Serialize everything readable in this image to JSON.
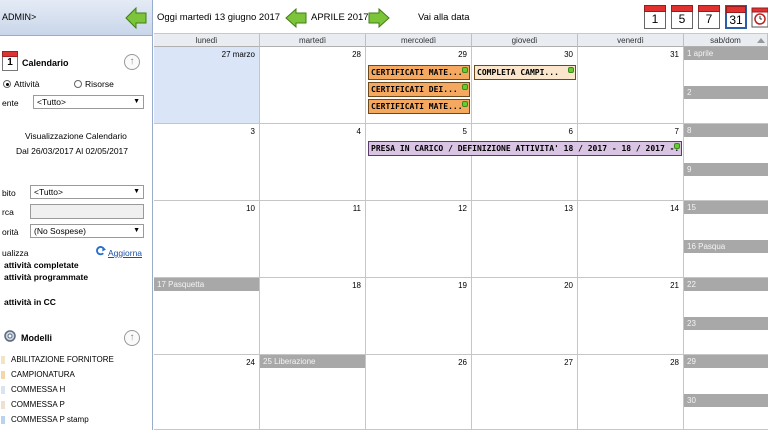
{
  "user": {
    "label": "ADMIN>"
  },
  "sidebar": {
    "calendar_section": {
      "icon_text": "1",
      "title": "Calendario"
    },
    "radio_activities": "Attività",
    "radio_resources": "Risorse",
    "client_label": "ente",
    "client_value": "<Tutto>",
    "view_title": "Visualizzazione Calendario",
    "view_range": "Dal 26/03/2017 Al 02/05/2017",
    "scope_label": "bito",
    "scope_value": "<Tutto>",
    "search_label": "rca",
    "priority_label": "orità",
    "priority_value": "(No Sospese)",
    "visualize_label": "ualizza",
    "refresh_label": "Aggiorna",
    "opt_completed": "attività completate",
    "opt_scheduled": "attività programmate",
    "opt_cc": "attività in CC",
    "models_title": "Modelli",
    "models": [
      {
        "label": "ABILITAZIONE FORNITORE",
        "color": "#f2e4c4"
      },
      {
        "label": "CAMPIONATURA",
        "color": "#f4d6a8"
      },
      {
        "label": "COMMESSA H",
        "color": "#d9e4f2"
      },
      {
        "label": "COMMESSA P",
        "color": "#f0e0d0"
      },
      {
        "label": "COMMESSA P stamp",
        "color": "#b9d2ee"
      }
    ]
  },
  "toolbar": {
    "today_text": "Oggi martedì 13 giugno 2017",
    "month_label": "APRILE 2017",
    "goto_label": "Vai alla data",
    "view_buttons": [
      "1",
      "5",
      "7",
      "31"
    ]
  },
  "calendar": {
    "weekdays": [
      "lunedì",
      "martedì",
      "mercoledì",
      "giovedì",
      "venerdì",
      "sab/dom"
    ],
    "weeks": [
      {
        "days": [
          "27 marzo",
          "28",
          "29",
          "30",
          "31"
        ],
        "sat": "1 aprile",
        "sun": "2"
      },
      {
        "days": [
          "3",
          "4",
          "5",
          "6",
          "7"
        ],
        "sat": "8",
        "sun": "9"
      },
      {
        "days": [
          "10",
          "11",
          "12",
          "13",
          "14"
        ],
        "sat": "15",
        "sun": "16 Pasqua"
      },
      {
        "days": [
          "17 Pasquetta",
          "18",
          "19",
          "20",
          "21"
        ],
        "sat": "22",
        "sun": "23"
      },
      {
        "days": [
          "24",
          "25 Liberazione",
          "26",
          "27",
          "28"
        ],
        "sat": "29",
        "sun": "30"
      }
    ],
    "events": {
      "e1": "CERTIFICATI MATE...",
      "e2": "CERTIFICATI DEI...",
      "e3": "CERTIFICATI MATE...",
      "e4": "COMPLETA CAMPI...",
      "e5": "PRESA IN CARICO / DEFINIZIONE ATTIVITA' 18 / 2017 - 18 / 2017 -..."
    },
    "colors": {
      "event_orange": "#f4a860",
      "event_purple": "#d9c4e4",
      "today_bg": "#dae6f8",
      "holiday_gray": "#a8a8a8"
    }
  }
}
